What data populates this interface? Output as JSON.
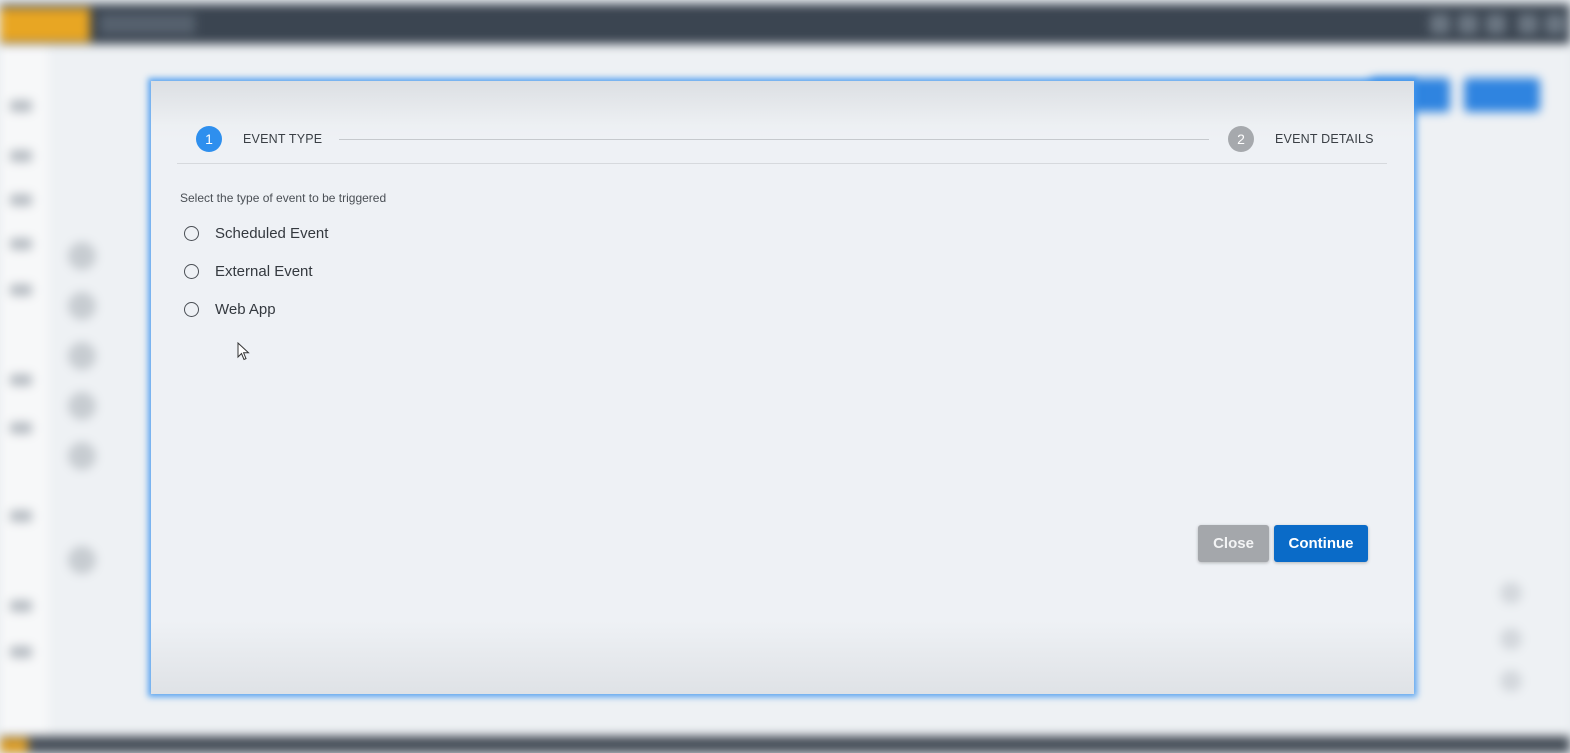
{
  "dialog": {
    "steps": [
      {
        "number": "1",
        "label": "EVENT TYPE",
        "state": "active"
      },
      {
        "number": "2",
        "label": "EVENT DETAILS",
        "state": "inactive"
      }
    ],
    "prompt": "Select the type of event to be triggered",
    "options": [
      {
        "label": "Scheduled Event",
        "selected": false
      },
      {
        "label": "External Event",
        "selected": false
      },
      {
        "label": "Web App",
        "selected": false
      }
    ],
    "buttons": {
      "close_label": "Close",
      "continue_label": "Continue"
    }
  },
  "colors": {
    "accent": "#2e8fee",
    "primary_button": "#0a6bc8",
    "secondary_button": "#a4a7ab",
    "dialog_glow": "#4296ee"
  }
}
